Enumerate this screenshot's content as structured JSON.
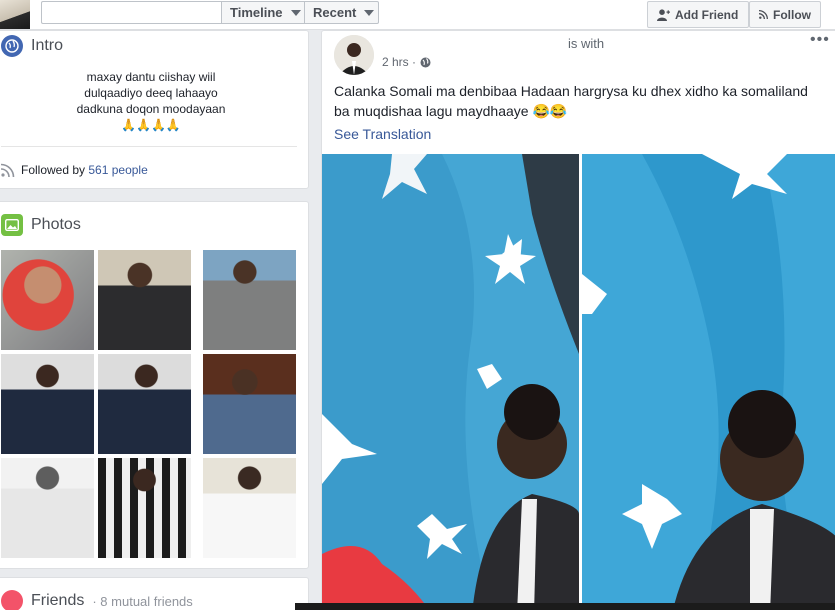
{
  "topbar": {
    "search_value": "",
    "tabs": [
      "Timeline",
      "Recent"
    ],
    "add_friend_label": "Add Friend",
    "follow_label": "Follow"
  },
  "intro": {
    "title": "Intro",
    "bio_lines": [
      "maxay dantu ciishay wiil",
      "dulqaadiyo deeq lahaayo",
      "dadkuna doqon moodayaan"
    ],
    "bio_emoji": "🙏🙏🙏🙏",
    "followed_prefix": "Followed by ",
    "followed_link": "561 people"
  },
  "photos": {
    "title": "Photos"
  },
  "friends": {
    "title": "Friends",
    "subtitle": "· 8 mutual friends"
  },
  "post": {
    "with_text": "is with",
    "time": "2 hrs ·",
    "privacy_icon": "globe-icon",
    "text": "Calanka Somali ma denbibaa Hadaan hargrysa ku dhex xidho ka somaliland ba muqdishaa lagu maydhaaye 😂😂",
    "see_translation": "See Translation",
    "more": "•••"
  },
  "colors": {
    "facebook_blue": "#385898",
    "page_bg": "#e9ebee",
    "flag_blue": "#3ea7d8",
    "intro_icon": "#4267b2",
    "photos_icon": "#74c043"
  }
}
